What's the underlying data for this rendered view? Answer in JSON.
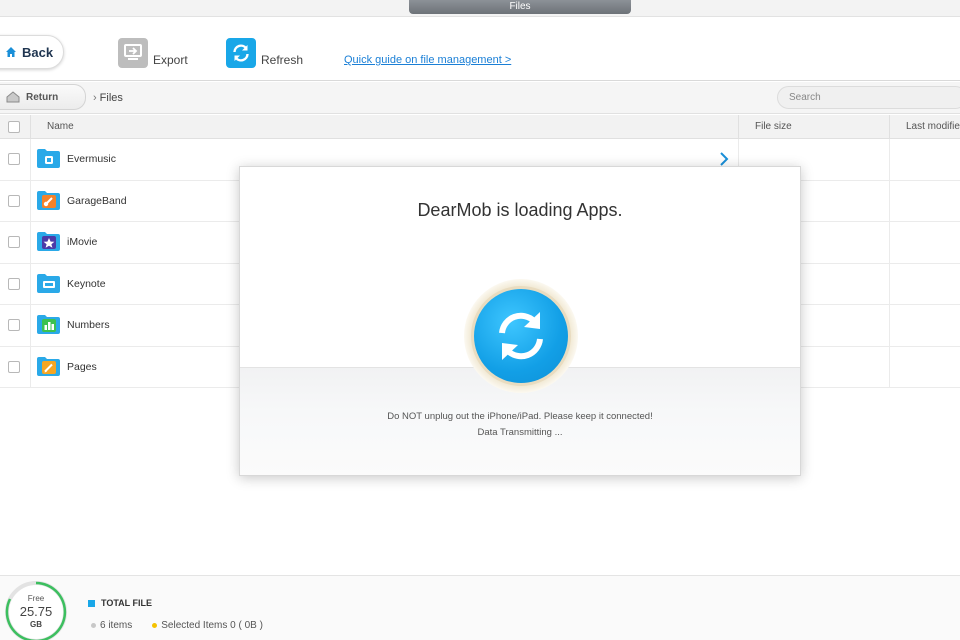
{
  "window": {
    "title": "Files"
  },
  "toolbar": {
    "back_label": "Back",
    "export_label": "Export",
    "refresh_label": "Refresh",
    "guide_link": "Quick guide on file management >"
  },
  "breadcrumb": {
    "return_label": "Return",
    "current": "Files"
  },
  "search": {
    "placeholder": "Search"
  },
  "table": {
    "columns": {
      "name": "Name",
      "size": "File size",
      "modified": "Last modified"
    },
    "rows": [
      {
        "name": "Evermusic",
        "icon": "evermusic-folder-icon"
      },
      {
        "name": "GarageBand",
        "icon": "garageband-folder-icon"
      },
      {
        "name": "iMovie",
        "icon": "imovie-folder-icon"
      },
      {
        "name": "Keynote",
        "icon": "keynote-folder-icon"
      },
      {
        "name": "Numbers",
        "icon": "numbers-folder-icon"
      },
      {
        "name": "Pages",
        "icon": "pages-folder-icon"
      }
    ]
  },
  "footer": {
    "storage_label": "Free",
    "storage_value": "25.75",
    "storage_unit": "GB",
    "total_label": "TOTAL FILE",
    "items_count": "6 items",
    "selected_items": "Selected Items 0 ( 0B )"
  },
  "modal": {
    "title": "DearMob is loading Apps.",
    "warning": "Do NOT unplug out the iPhone/iPad. Please keep it connected!",
    "status": "Data Transmitting ..."
  },
  "colors": {
    "accent": "#19a7e8",
    "link": "#1a7fd6",
    "selected_dot": "#f5c200"
  }
}
